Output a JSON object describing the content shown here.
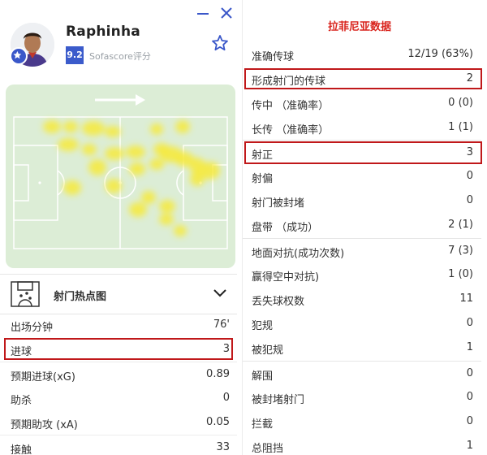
{
  "player": {
    "name": "Raphinha",
    "rating": "9.2",
    "rating_label": "Sofascore评分"
  },
  "icons": {
    "minimize": "minimize-icon",
    "close": "close-icon",
    "favorite": "star-outline-icon",
    "avatar_badge": "star-badge-icon",
    "shotmap": "shot-map-icon",
    "expand": "chevron-down-icon",
    "attack_direction": "arrow-right-icon"
  },
  "colors": {
    "accent_blue": "#3b5bcb",
    "title_red": "#d9241d",
    "highlight_red": "#c0181a",
    "pitch_green": "#dcedd6",
    "heat_yellow": "#f7ea3b"
  },
  "heatmap": {
    "label": "射门热点图"
  },
  "left_stats": [
    {
      "label": "出场分钟",
      "value": "76'"
    },
    {
      "label": "进球",
      "value": "3",
      "highlighted": true
    },
    {
      "label": "预期进球(xG)",
      "value": "0.89"
    },
    {
      "label": "助杀",
      "value": "0"
    },
    {
      "label": "预期助攻 (xA)",
      "value": "0.05"
    },
    {
      "label": "接触",
      "value": "33"
    }
  ],
  "right_panel": {
    "title": "拉菲尼亚数据",
    "stats": [
      {
        "label": "准确传球",
        "value": "12/19 (63%)"
      },
      {
        "label": "形成射门的传球",
        "value": "2",
        "highlighted": true
      },
      {
        "label": "传中 （准确率）",
        "value": "0 (0)"
      },
      {
        "label": "长传 （准确率）",
        "value": "1 (1)"
      },
      {
        "label": "射正",
        "value": "3",
        "highlighted": true
      },
      {
        "label": "射偏",
        "value": "0"
      },
      {
        "label": "射门被封堵",
        "value": "0"
      },
      {
        "label": "盘带 （成功）",
        "value": "2 (1)"
      },
      {
        "label": "地面对抗(成功次数)",
        "value": "7 (3)"
      },
      {
        "label": "赢得空中对抗)",
        "value": "1 (0)"
      },
      {
        "label": "丢失球权数",
        "value": "11"
      },
      {
        "label": "犯规",
        "value": "0"
      },
      {
        "label": "被犯规",
        "value": "1"
      },
      {
        "label": "解围",
        "value": "0"
      },
      {
        "label": "被封堵射门",
        "value": "0"
      },
      {
        "label": "拦截",
        "value": "0"
      },
      {
        "label": "总阻挡",
        "value": "1"
      }
    ]
  }
}
